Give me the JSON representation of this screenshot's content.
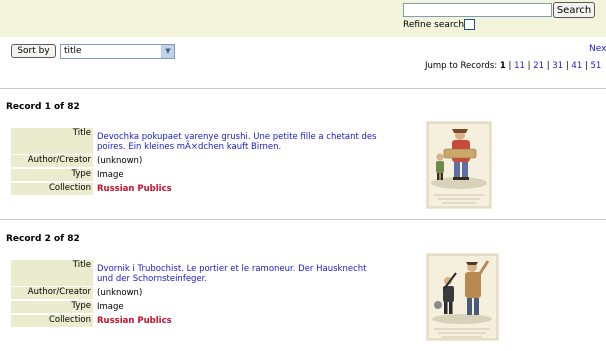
{
  "search": {
    "button_label": "Search",
    "refine_label": "Refine search",
    "query": ""
  },
  "sort": {
    "button_label": "Sort by",
    "selected": "title"
  },
  "pagination": {
    "next_label": "Next",
    "jump_label": "Jump to Records:",
    "current": "1",
    "pages": [
      "11",
      "21",
      "31",
      "41",
      "51"
    ]
  },
  "fields": {
    "title": "Title",
    "author": "Author/Creator",
    "type": "Type",
    "collection": "Collection"
  },
  "records": [
    {
      "heading": "Record 1 of 82",
      "title": "Devochka pokupaet varenye grushi. Une petite fille a chetant des poires. Ein kleines mÃ×dchen kauft Birnen.",
      "author": "(unknown)",
      "type": "Image",
      "collection": "Russian Publics"
    },
    {
      "heading": "Record 2 of 82",
      "title": "Dvornik i Trubochist. Le portier et le ramoneur. Der Hausknecht und der Schornsteinfeger.",
      "author": "(unknown)",
      "type": "Image",
      "collection": "Russian Publics"
    }
  ],
  "colors": {
    "top_band": "#f2f4dc",
    "label_bg": "#eaeccd",
    "link": "#1a1ad0",
    "collection": "#c8102e"
  }
}
